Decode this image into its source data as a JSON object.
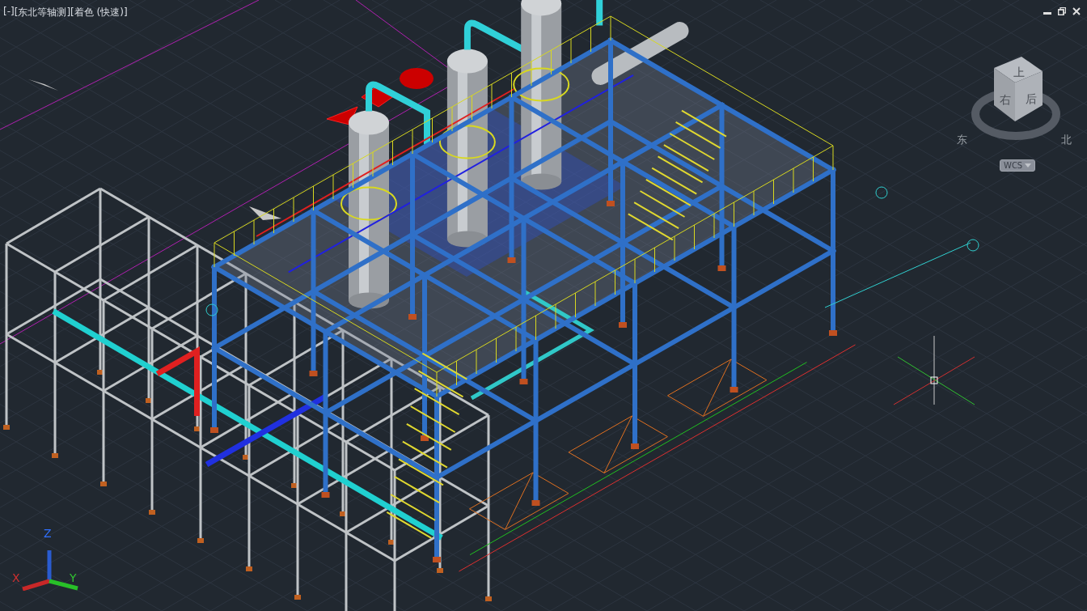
{
  "viewport": {
    "menus": [
      "[-]",
      "[东北等轴测]",
      "[着色 (快速)]"
    ]
  },
  "view_cube": {
    "faces": [
      "上",
      "右",
      "后"
    ],
    "compass": [
      "东",
      "北"
    ],
    "coordinate_system": "WCS"
  },
  "ucs_icon": {
    "axes": [
      "Z",
      "X",
      "Y"
    ]
  }
}
